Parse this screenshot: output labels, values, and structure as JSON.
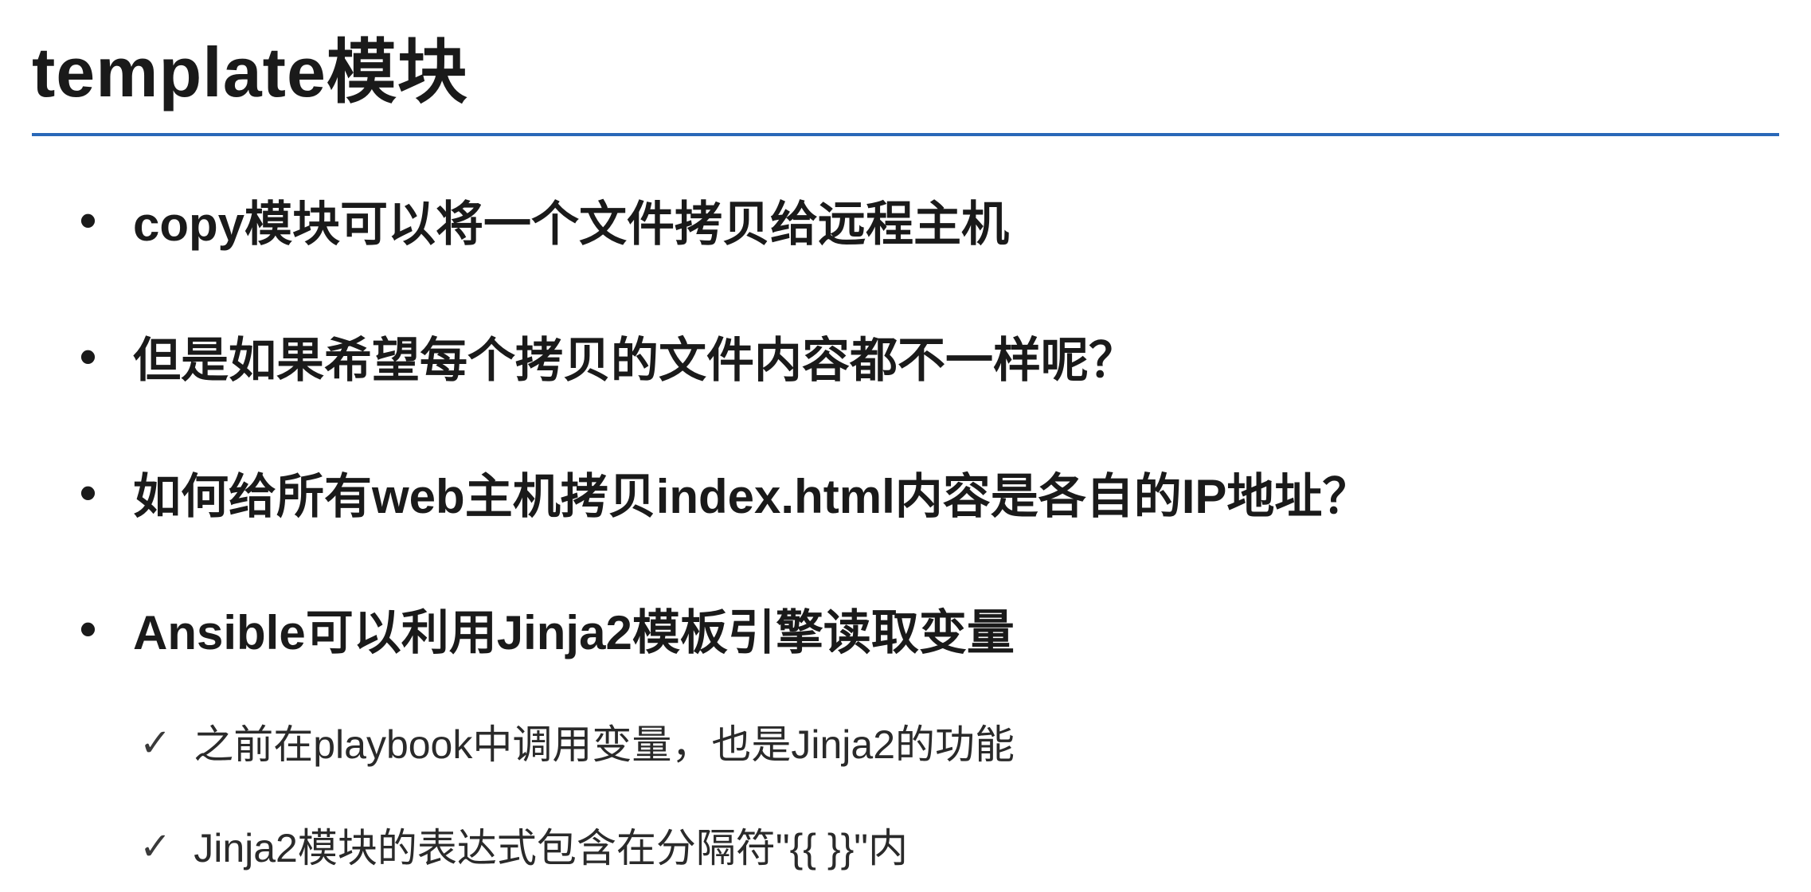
{
  "slide": {
    "title": "template模块",
    "bullets": [
      "copy模块可以将一个文件拷贝给远程主机",
      "但是如果希望每个拷贝的文件内容都不一样呢？",
      "如何给所有web主机拷贝index.html内容是各自的IP地址？",
      "Ansible可以利用Jinja2模板引擎读取变量"
    ],
    "sub_bullets": [
      "之前在playbook中调用变量，也是Jinja2的功能",
      "Jinja2模块的表达式包含在分隔符\"{{    }}\"内"
    ]
  }
}
